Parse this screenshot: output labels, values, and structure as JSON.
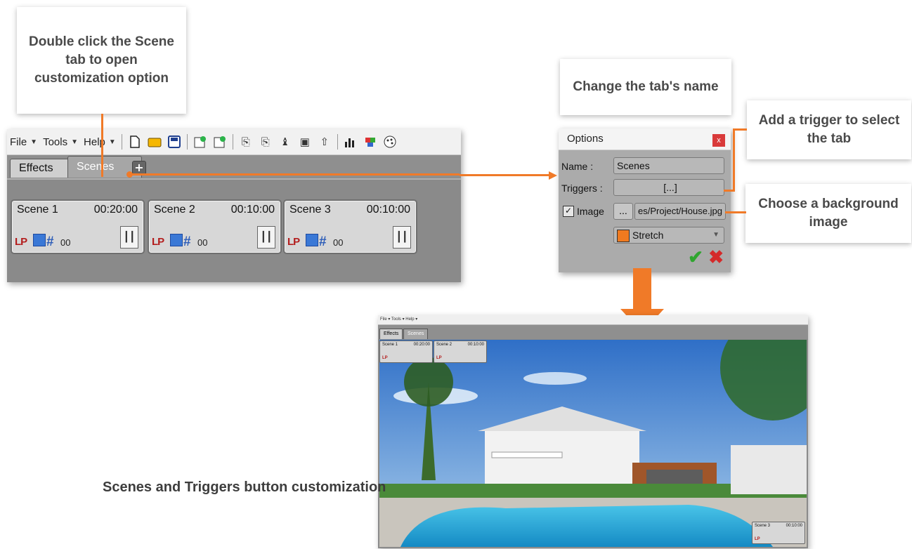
{
  "callouts": {
    "double_click": "Double click the Scene tab to open customization option",
    "change_name": "Change the tab's name",
    "add_trigger": "Add a trigger to select the tab",
    "choose_image": "Choose a background image"
  },
  "caption": "Scenes and Triggers button customization",
  "colors": {
    "accent": "#f07a28",
    "app_bg": "#8a8a8a",
    "close_red": "#d93a3a"
  },
  "left_window": {
    "menu": {
      "file": "File",
      "tools": "Tools",
      "help": "Help"
    },
    "tabs": {
      "effects": "Effects",
      "scenes": "Scenes",
      "add": "+"
    },
    "scenes": [
      {
        "name": "Scene 1",
        "time": "00:20:00",
        "lp": "LP",
        "count": "00"
      },
      {
        "name": "Scene 2",
        "time": "00:10:00",
        "lp": "LP",
        "count": "00"
      },
      {
        "name": "Scene 3",
        "time": "00:10:00",
        "lp": "LP",
        "count": "00"
      }
    ],
    "icons": [
      "new-file-icon",
      "open-folder-icon",
      "save-icon",
      "import-icon",
      "export-icon",
      "rotate-icon",
      "flip-icon",
      "fixture-icon",
      "image-icon",
      "up-arrow-icon",
      "chart-icon",
      "cube-icon",
      "palette-icon"
    ]
  },
  "dialog": {
    "title": "Options",
    "close": "x",
    "name_label": "Name :",
    "name_value": "Scenes",
    "triggers_label": "Triggers :",
    "triggers_value": "[...]",
    "image_check": "✓",
    "image_label": "Image",
    "dots": "...",
    "image_path": "es/Project/House.jpg",
    "mode": "Stretch",
    "ok": "✔",
    "cancel": "✖"
  },
  "preview": {
    "toolbar_text": "File ▾ Tools ▾ Help ▾",
    "tabs": {
      "effects": "Effects",
      "scenes": "Scenes"
    },
    "scenes": [
      {
        "name": "Scene 1",
        "time": "00:20:00",
        "lp": "LP"
      },
      {
        "name": "Scene 2",
        "time": "00:10:00",
        "lp": "LP"
      },
      {
        "name": "Scene 3",
        "time": "00:10:00",
        "lp": "LP"
      }
    ]
  }
}
